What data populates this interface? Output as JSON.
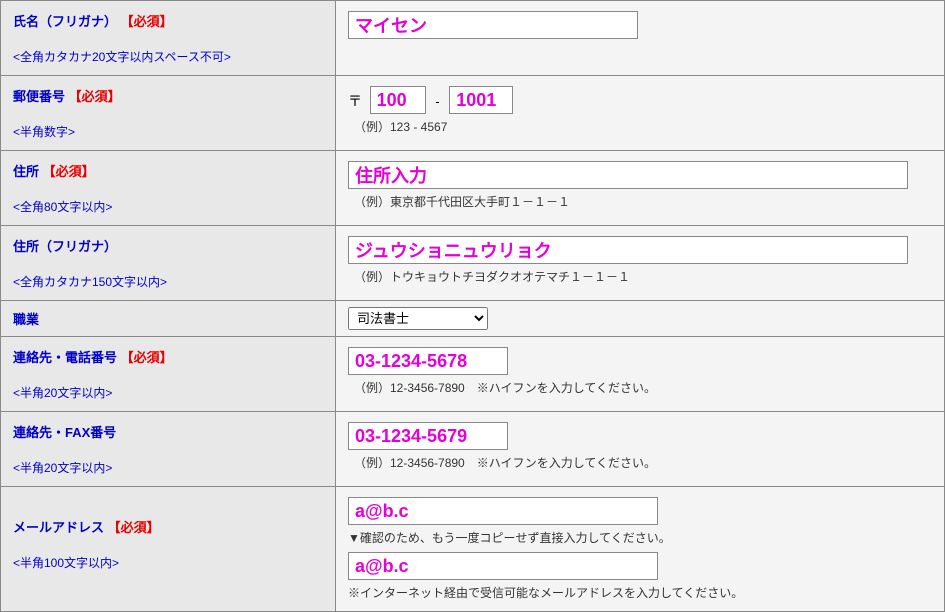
{
  "rows": {
    "name_kana": {
      "label": "氏名（フリガナ）",
      "required": "【必須】",
      "hint": "<全角カタカナ20文字以内スペース不可>",
      "value": "マイセン"
    },
    "postal": {
      "label": "郵便番号",
      "required": "【必須】",
      "hint": "<半角数字>",
      "symbol": "〒",
      "value1": "100",
      "value2": "1001",
      "dash": "-",
      "example": "（例）123 - 4567"
    },
    "address": {
      "label": "住所",
      "required": "【必須】",
      "hint": "<全角80文字以内>",
      "value": "住所入力",
      "example": "（例）東京都千代田区大手町１－１－１"
    },
    "address_kana": {
      "label": "住所（フリガナ）",
      "hint": "<全角カタカナ150文字以内>",
      "value": "ジュウショニュウリョク",
      "example": "（例）トウキョウトチヨダクオオテマチ１－１－１"
    },
    "occupation": {
      "label": "職業",
      "selected": "司法書士"
    },
    "phone": {
      "label": "連絡先・電話番号",
      "required": "【必須】",
      "hint": "<半角20文字以内>",
      "value": "03-1234-5678",
      "example": "（例）12-3456-7890　※ハイフンを入力してください。"
    },
    "fax": {
      "label": "連絡先・FAX番号",
      "hint": "<半角20文字以内>",
      "value": "03-1234-5679",
      "example": "（例）12-3456-7890　※ハイフンを入力してください。"
    },
    "email": {
      "label": "メールアドレス",
      "required": "【必須】",
      "hint": "<半角100文字以内>",
      "value1": "a@b.c",
      "confirm_msg": "▼確認のため、もう一度コピーせず直接入力してください。",
      "value2": "a@b.c",
      "note": "※インターネット経由で受信可能なメールアドレスを入力してください。"
    }
  }
}
